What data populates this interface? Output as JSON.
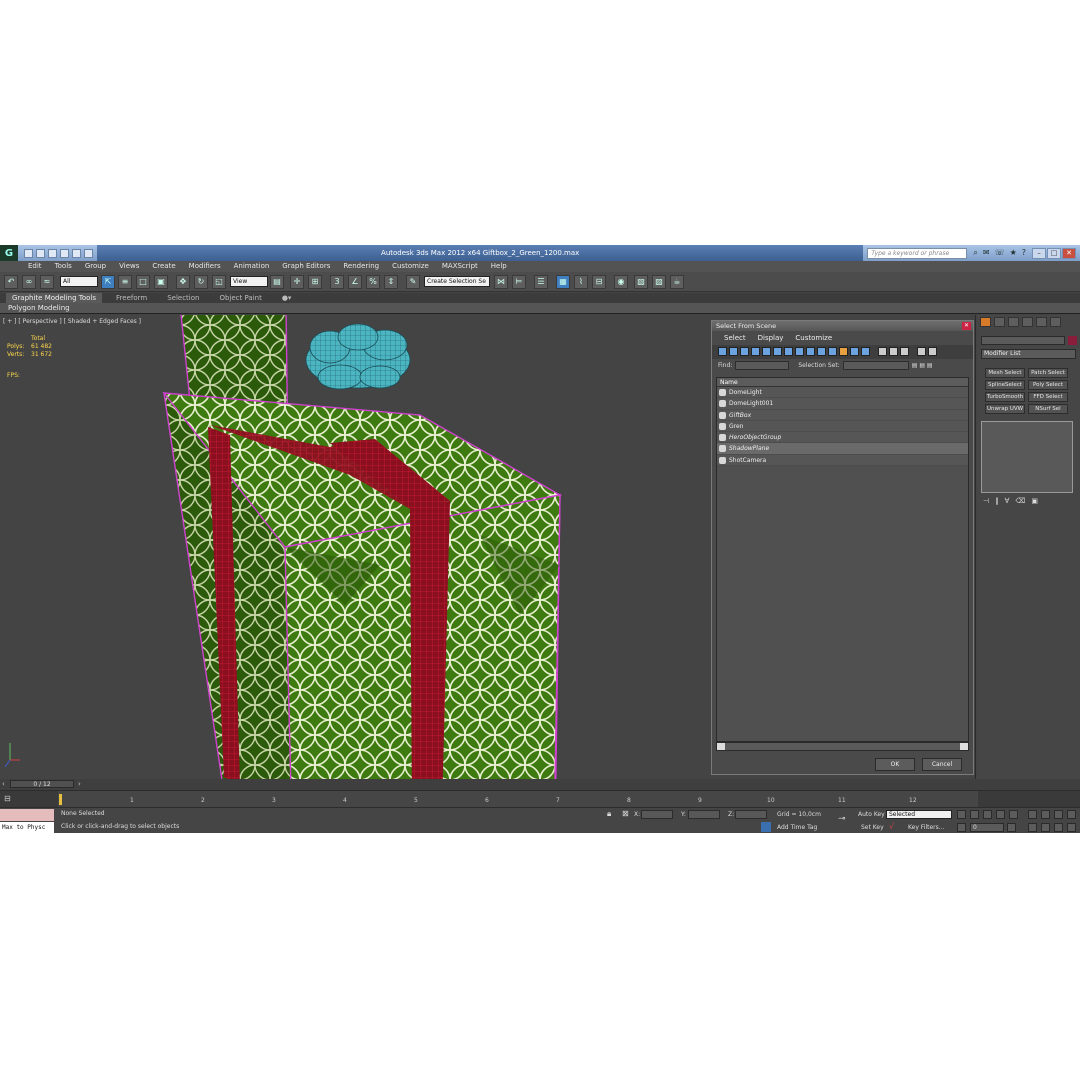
{
  "window": {
    "title": "Autodesk 3ds Max  2012 x64      Giftbox_2_Green_1200.max",
    "search_placeholder": "Type a keyword or phrase",
    "logo": "G",
    "minimize": "–",
    "restore": "□",
    "close": "✕"
  },
  "menu": [
    "Edit",
    "Tools",
    "Group",
    "Views",
    "Create",
    "Modifiers",
    "Animation",
    "Graph Editors",
    "Rendering",
    "Customize",
    "MAXScript",
    "Help"
  ],
  "toolbar": {
    "filter_value": "All",
    "refcoord_value": "View",
    "named_sel_value": "Create Selection Se"
  },
  "ribbon": {
    "tabs": [
      "Graphite Modeling Tools",
      "Freeform",
      "Selection",
      "Object Paint"
    ],
    "panel": "Polygon Modeling"
  },
  "viewport": {
    "label": "[ + ] [ Perspective ] [ Shaded + Edged Faces ]",
    "stats_header": "Total",
    "polys_label": "Polys:",
    "polys_value": "61 482",
    "verts_label": "Verts:",
    "verts_value": "31 672",
    "fps_label": "FPS:"
  },
  "dialog": {
    "title": "Select From Scene",
    "menu": [
      "Select",
      "Display",
      "Customize"
    ],
    "find_label": "Find:",
    "selection_set_label": "Selection Set:",
    "column_header": "Name",
    "items": [
      "DomeLight",
      "DomeLight001",
      "GiftBox",
      "Gren",
      "HeroObjectGroup",
      "ShadowPlane",
      "ShotCamera"
    ],
    "ok": "OK",
    "cancel": "Cancel"
  },
  "command_panel": {
    "modifier_list": "Modifier List",
    "buttons": [
      "Mesh Select",
      "Patch Select",
      "SplineSelect",
      "Poly Select",
      "TurboSmooth",
      "FFD Select",
      "Unwrap UVW",
      "NSurf Sel"
    ]
  },
  "timeline": {
    "frame_counter": "0 / 12",
    "ticks": [
      "1",
      "2",
      "3",
      "4",
      "5",
      "6",
      "7",
      "8",
      "9",
      "10",
      "11",
      "12"
    ]
  },
  "status": {
    "max_to_physc": "Max to Physc",
    "selection": "None Selected",
    "prompt": "Click or click-and-drag to select objects",
    "x_label": "X:",
    "y_label": "Y:",
    "z_label": "Z:",
    "grid": "Grid = 10,0cm",
    "add_time_tag": "Add Time Tag",
    "auto_key": "Auto Key",
    "set_key": "Set Key",
    "selected_dropdown": "Selected",
    "key_filters": "Key Filters...",
    "frame_field": "0"
  },
  "colors": {
    "gift_green": "#3d7a0f",
    "ribbon_red": "#b2182b",
    "bow_cyan": "#3aa3b0",
    "selection_outline": "#d040d0"
  }
}
